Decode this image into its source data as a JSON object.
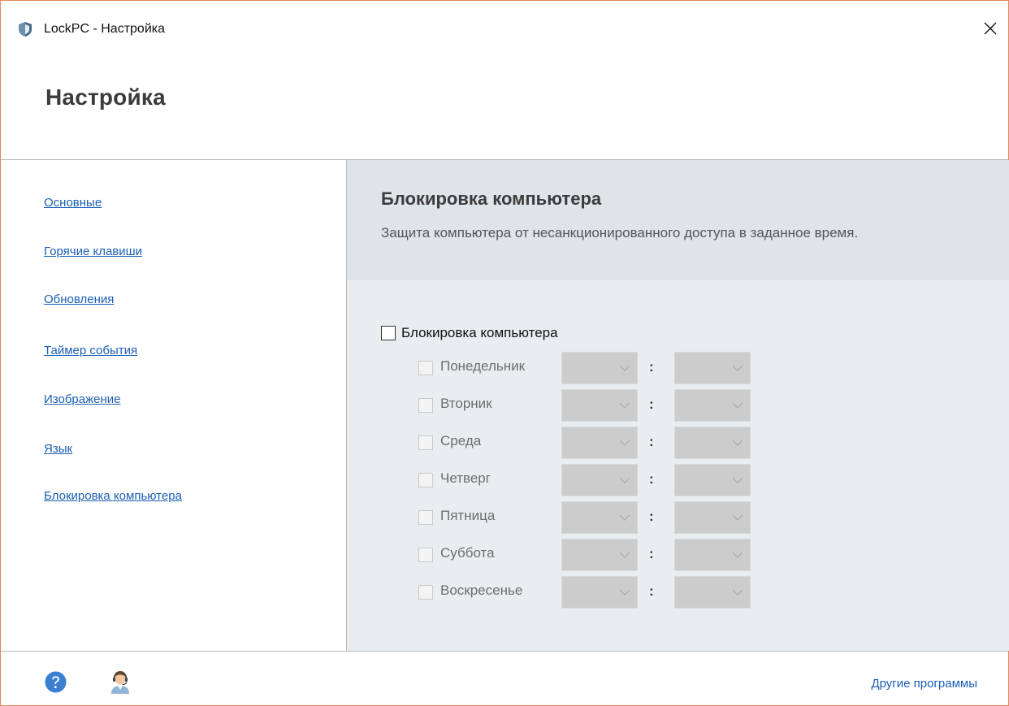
{
  "window": {
    "title": "LockPC - Настройка",
    "accent_color": "#1b5fb5",
    "border_color": "#e08a5a"
  },
  "header": {
    "page_title": "Настройка"
  },
  "sidebar": {
    "items": [
      {
        "label": "Основные"
      },
      {
        "label": "Горячие клавиши"
      },
      {
        "label": "Обновления"
      },
      {
        "label": "Таймер события"
      },
      {
        "label": "Изображение"
      },
      {
        "label": "Язык"
      },
      {
        "label": "Блокировка компьютера"
      }
    ]
  },
  "content": {
    "title": "Блокировка компьютера",
    "description": "Защита компьютера от несанкционированного доступа в заданное время.",
    "main_checkbox": {
      "label": "Блокировка компьютера",
      "checked": false
    },
    "separator": ":",
    "days": [
      {
        "label": "Понедельник",
        "checked": false,
        "enabled": false
      },
      {
        "label": "Вторник",
        "checked": false,
        "enabled": false
      },
      {
        "label": "Среда",
        "checked": false,
        "enabled": false
      },
      {
        "label": "Четверг",
        "checked": false,
        "enabled": false
      },
      {
        "label": "Пятница",
        "checked": false,
        "enabled": false
      },
      {
        "label": "Суббота",
        "checked": false,
        "enabled": false
      },
      {
        "label": "Воскресенье",
        "checked": false,
        "enabled": false
      }
    ]
  },
  "footer": {
    "help_icon": "question-circle-icon",
    "support_icon": "support-agent-icon",
    "other_programs_label": "Другие программы"
  }
}
